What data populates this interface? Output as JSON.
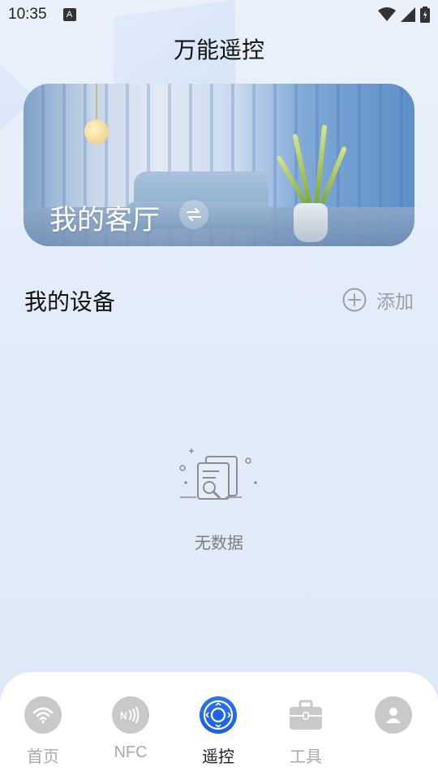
{
  "status_bar": {
    "time": "10:35",
    "notification_icon": "A"
  },
  "header": {
    "title": "万能遥控"
  },
  "room_banner": {
    "room_name": "我的客厅",
    "swap_icon": "swap-arrows-icon"
  },
  "devices_section": {
    "title": "我的设备",
    "add_label": "添加"
  },
  "empty_state": {
    "message": "无数据"
  },
  "bottom_nav": {
    "items": [
      {
        "label": "首页",
        "icon": "wifi-icon",
        "active": false
      },
      {
        "label": "NFC",
        "icon": "nfc-icon",
        "active": false
      },
      {
        "label": "遥控",
        "icon": "remote-dpad-icon",
        "active": true
      },
      {
        "label": "工具",
        "icon": "toolbox-icon",
        "active": false
      },
      {
        "label": "",
        "icon": "user-icon",
        "active": false
      }
    ]
  },
  "colors": {
    "accent": "#1f63e6",
    "inactive_icon": "#c9c9c9",
    "inactive_text": "#a9a9a9"
  }
}
